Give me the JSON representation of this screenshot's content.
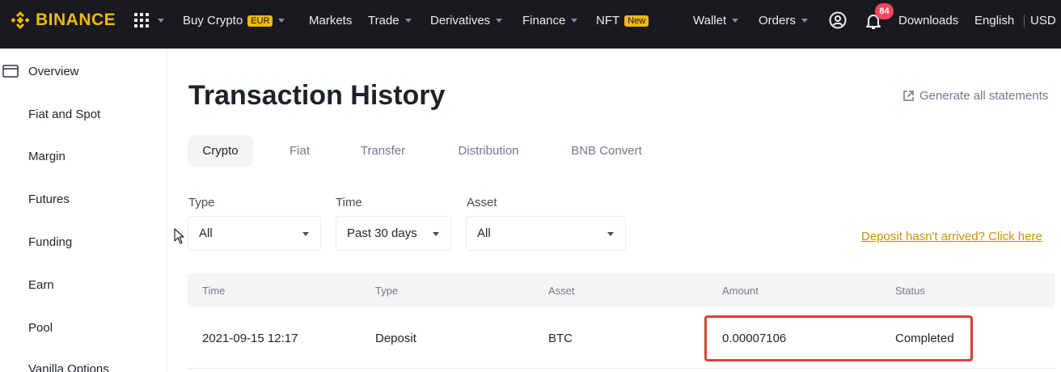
{
  "brand": {
    "name": "BINANCE",
    "color": "#f0b90b"
  },
  "topnav": {
    "buy_crypto": "Buy Crypto",
    "buy_crypto_badge": "EUR",
    "markets": "Markets",
    "trade": "Trade",
    "derivatives": "Derivatives",
    "finance": "Finance",
    "nft": "NFT",
    "nft_badge": "New",
    "wallet": "Wallet",
    "orders": "Orders",
    "notifications_count": "84",
    "downloads": "Downloads",
    "language": "English",
    "currency": "USD"
  },
  "sidebar": {
    "items": [
      {
        "label": "Overview",
        "icon": "wallet-icon"
      },
      {
        "label": "Fiat and Spot"
      },
      {
        "label": "Margin"
      },
      {
        "label": "Futures"
      },
      {
        "label": "Funding"
      },
      {
        "label": "Earn"
      },
      {
        "label": "Pool"
      },
      {
        "label": "Vanilla Options"
      }
    ]
  },
  "main": {
    "title": "Transaction History",
    "generate_statements": "Generate all statements",
    "tabs": [
      "Crypto",
      "Fiat",
      "Transfer",
      "Distribution",
      "BNB Convert"
    ],
    "active_tab": "Crypto",
    "filters": {
      "type_label": "Type",
      "type_value": "All",
      "time_label": "Time",
      "time_value": "Past 30 days",
      "asset_label": "Asset",
      "asset_value": "All"
    },
    "deposit_link": "Deposit hasn't arrived? Click here",
    "table": {
      "columns": [
        "Time",
        "Type",
        "Asset",
        "Amount",
        "Status"
      ],
      "rows": [
        {
          "time": "2021-09-15 12:17",
          "type": "Deposit",
          "asset": "BTC",
          "amount": "0.00007106",
          "status": "Completed"
        }
      ]
    }
  },
  "colors": {
    "topbar": "#181a20",
    "accent": "#f0b90b",
    "link": "#c99400",
    "highlight_box": "#d9403a",
    "badge": "#f6465d"
  }
}
